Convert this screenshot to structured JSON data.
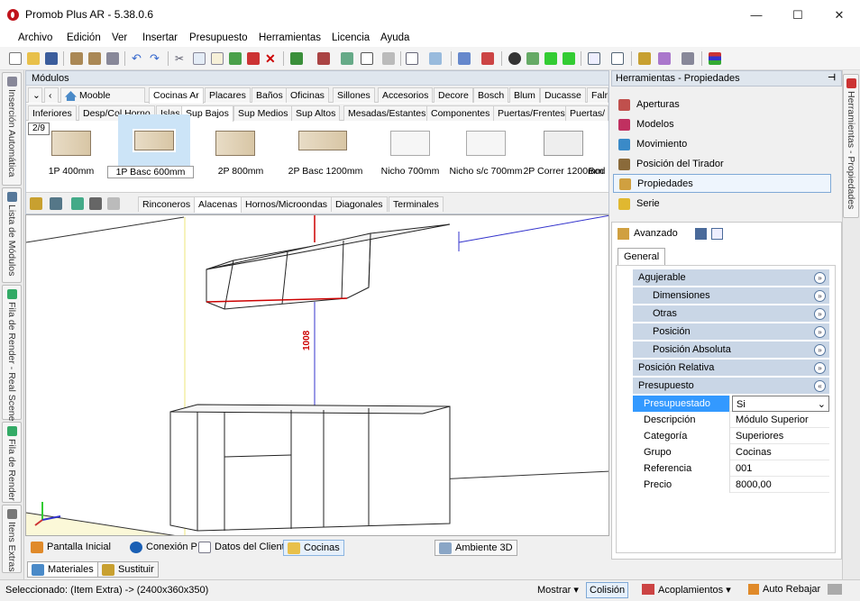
{
  "window": {
    "title": "Promob Plus AR - 5.38.0.6",
    "min": "—",
    "max": "☐",
    "close": "✕"
  },
  "menu": [
    "Archivo",
    "Edición",
    "Ver",
    "Insertar",
    "Presupuesto",
    "Herramientas",
    "Licencia",
    "Ayuda"
  ],
  "left_tabs": [
    "Inserción Automática",
    "Lista de Módulos",
    "Fila de Render - Real Scene",
    "Fila de Render",
    "Itens Extras"
  ],
  "modules": {
    "header": "Módulos",
    "library": "Mooble",
    "tabs1": [
      "Cocinas Ar",
      "Placares",
      "Baños",
      "Oficinas",
      "Sillones",
      "Accesorios",
      "Decore",
      "Bosch",
      "Blum",
      "Ducasse",
      "Falr"
    ],
    "tabs2": [
      "Inferiores",
      "Desp/Col.Horno",
      "Islas",
      "Sup Bajos",
      "Sup Medios",
      "Sup Altos",
      "Mesadas/Estantes",
      "Componentes",
      "Puertas/Frentes",
      "Puertas/"
    ],
    "page": "2/9",
    "items": [
      "1P 400mm",
      "1P Basc 600mm",
      "2P 800mm",
      "2P Basc 1200mm",
      "Nicho 700mm",
      "Nicho s/c 700mm",
      "2P Correr 1200mm",
      "Bod"
    ],
    "subtabs": [
      "Rinconeros",
      "Alacenas",
      "Hornos/Microondas",
      "Diagonales",
      "Terminales"
    ]
  },
  "viewport": {
    "dimension": "1008"
  },
  "bottom": {
    "buttons": [
      "Pantalla Inicial",
      "Conexión P",
      "Datos del Cliente",
      "Cocinas",
      "Ambiente 3D"
    ],
    "tabs": [
      "Materiales",
      "Sustituir"
    ]
  },
  "status": {
    "selection": "Seleccionado: (Item Extra) -> (2400x360x350)",
    "mostrar": "Mostrar",
    "colision": "Colisión",
    "acoplamientos": "Acoplamientos",
    "auto": "Auto Rebajar"
  },
  "right_panel": {
    "header": "Herramientas - Propiedades",
    "items": [
      "Aperturas",
      "Modelos",
      "Movimiento",
      "Posición del Tirador",
      "Propiedades",
      "Serie"
    ],
    "mode": "Avanzado",
    "tab": "General",
    "categories": [
      "Agujerable",
      "Dimensiones",
      "Otras",
      "Posición",
      "Posición Absoluta",
      "Posición Relativa",
      "Presupuesto"
    ],
    "props": [
      {
        "k": "Presupuestado",
        "v": "Si"
      },
      {
        "k": "Descripción",
        "v": "Módulo Superior"
      },
      {
        "k": "Categoría",
        "v": "Superiores"
      },
      {
        "k": "Grupo",
        "v": "Cocinas"
      },
      {
        "k": "Referencia",
        "v": "001"
      },
      {
        "k": "Precio",
        "v": "8000,00"
      }
    ],
    "side_tab": "Herramientas - Propiedades"
  },
  "colors": {
    "accent": "#3399ff",
    "logo": "#c0151d",
    "category": "#c9d6e6"
  }
}
